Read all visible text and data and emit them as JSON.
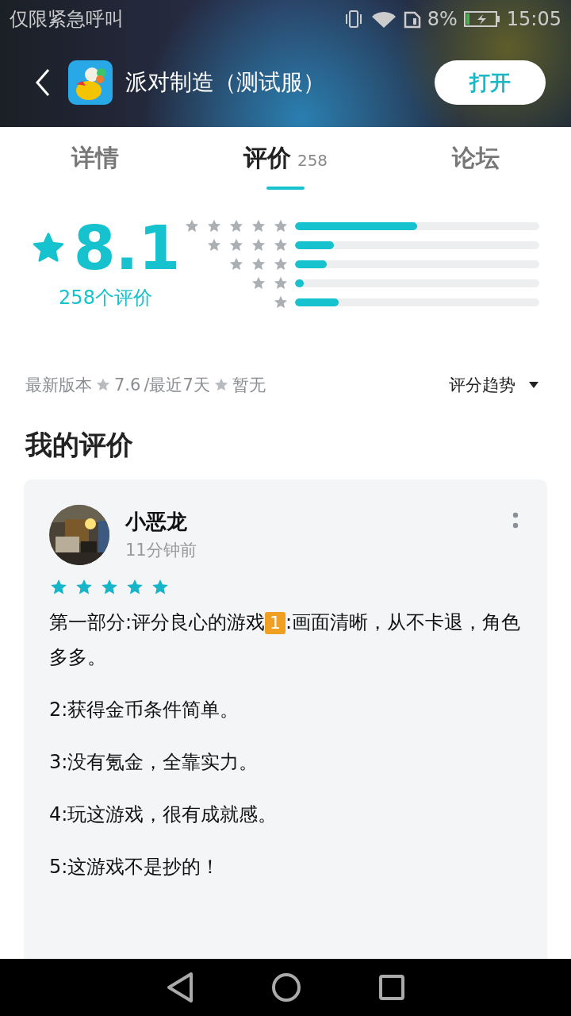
{
  "status_bar": {
    "carrier": "仅限紧急呼叫",
    "battery": "8%",
    "time": "15:05"
  },
  "header": {
    "title": "派对制造（测试服）",
    "open_button": "打开"
  },
  "tabs": [
    {
      "label": "详情",
      "selected": false
    },
    {
      "label": "评价",
      "count": "258",
      "selected": true
    },
    {
      "label": "论坛",
      "selected": false
    }
  ],
  "rating": {
    "score": "8.1",
    "count_label": "258个评价",
    "distribution": [
      {
        "level": 0.5
      },
      {
        "level": 0.16
      },
      {
        "level": 0.13
      },
      {
        "level": 0.036
      },
      {
        "level": 0.18
      }
    ]
  },
  "version_info": {
    "label": "最新版本",
    "version_score": "7.6",
    "recent_label": "/最近7天",
    "recent_score": "暂无",
    "trend_button": "评分趋势"
  },
  "my_review": {
    "heading": "我的评价",
    "user": "小恶龙",
    "time": "11分钟前",
    "stars": 5,
    "paragraphs": [
      {
        "before": "第一部分:评分良心的游戏",
        "badge": "1",
        "after": ":画面清晰，从不卡退，角色多多。"
      },
      {
        "before": "2:获得金币条件简单。"
      },
      {
        "before": "3:没有氪金，全靠实力。"
      },
      {
        "before": "4:玩这游戏，很有成就感。"
      },
      {
        "before": "5:这游戏不是抄的！"
      }
    ]
  }
}
